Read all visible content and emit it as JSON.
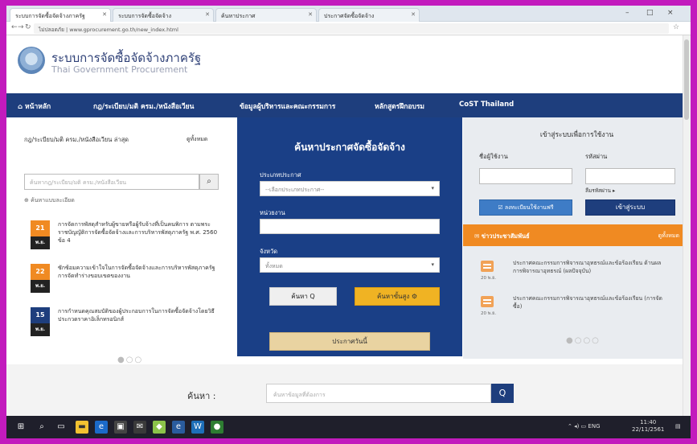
{
  "browser": {
    "tabs": [
      {
        "label": "ระบบการจัดซื้อจัดจ้างภาครัฐ"
      },
      {
        "label": "ระบบการจัดซื้อจัดจ้าง"
      },
      {
        "label": "ค้นหาประกาศ"
      },
      {
        "label": "ประกาศจัดซื้อจัดจ้าง"
      }
    ],
    "window_controls": [
      "–",
      "□",
      "×"
    ],
    "url": "ไม่ปลอดภัย | www.gprocurement.go.th/new_index.html"
  },
  "site": {
    "title": "ระบบการจัดซื้อจัดจ้างภาครัฐ",
    "subtitle": "Thai Government Procurement"
  },
  "nav": {
    "items": [
      "หน้าหลัก",
      "กฎ/ระเบียบ/มติ ครม./หนังสือเวียน",
      "ข้อมูลผู้บริหารและคณะกรรมการ",
      "หลักสูตรฝึกอบรม",
      "CoST Thailand"
    ]
  },
  "left": {
    "title": "กฎ/ระเบียบ/มติ ครม./หนังสือเวียน ล่าสุด",
    "more": "ดูทั้งหมด",
    "search_placeholder": "ค้นหากฎ/ระเบียบ/มติ ครม./หนังสือเวียน",
    "search_icon": "magnifier",
    "advanced_link": "ค้นหาแบบละเอียด",
    "news": [
      {
        "day": "21",
        "month": "พ.ย.",
        "color": "#f08a22",
        "text": "การจัดการพัสดุสำหรับผู้ขายหรือผู้รับจ้างที่เป็นคนพิการ ตามพระราชบัญญัติการจัดซื้อจัดจ้างและการบริหารพัสดุภาครัฐ พ.ศ. 2560 ข้อ 4"
      },
      {
        "day": "22",
        "month": "พ.ย.",
        "color": "#f08a22",
        "text": "ซักซ้อมความเข้าใจในการจัดซื้อจัดจ้างและการบริหารพัสดุภาครัฐ การจัดทำร่างขอบเขตของงาน"
      },
      {
        "day": "15",
        "month": "พ.ย.",
        "color": "#1e3e7d",
        "text": "การกำหนดคุณสมบัติของผู้ประกอบการในการจัดซื้อจัดจ้างโดยวิธีประกวดราคาอิเล็กทรอนิกส์"
      }
    ]
  },
  "center": {
    "title": "ค้นหาประกาศจัดซื้อจัดจ้าง",
    "type_label": "ประเภทประกาศ",
    "type_value": "--เลือกประเภทประกาศ--",
    "agency_label": "หน่วยงาน",
    "agency_value": "",
    "province_label": "จังหวัด",
    "province_value": "ทั้งหมด",
    "caret": "▾",
    "search_button": "ค้นหา Q",
    "advanced_button": "ค้นหาขั้นสูง ⚙",
    "announce_button": "ประกาศวันนี้"
  },
  "right": {
    "title": "เข้าสู่ระบบเพื่อการใช้งาน",
    "username_label": "ชื่อผู้ใช้งาน",
    "password_label": "รหัสผ่าน",
    "forgot": "ลืมรหัสผ่าน ▸",
    "register_button": "☑ ลงทะเบียนใช้งานฟรี",
    "login_button": "เข้าสู่ระบบ",
    "news_bar_title": "✉ ข่าวประชาสัมพันธ์",
    "news_bar_more": "ดูทั้งหมด",
    "news": [
      {
        "date": "20 พ.ย.",
        "text": "ประกาศคณะกรรมการพิจารณาอุทธรณ์และข้อร้องเรียน ด้านผลการพิจารณาอุทธรณ์ (ผลปัจจุบัน)"
      },
      {
        "date": "20 พ.ย.",
        "text": "ประกาศคณะกรรมการพิจารณาอุทธรณ์และข้อร้องเรียน (การจัดซื้อ)"
      }
    ]
  },
  "bottom": {
    "label": "ค้นหา :",
    "placeholder": "ค้นหาข้อมูลที่ต้องการ",
    "button": "Q"
  },
  "taskbar": {
    "start": "⊞",
    "time": "11:40",
    "date": "22/11/2561",
    "lang": "ENG"
  }
}
